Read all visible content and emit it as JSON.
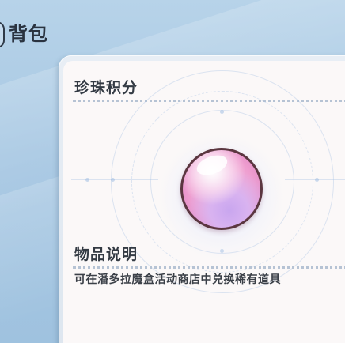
{
  "header": {
    "title": "背包",
    "back_icon": "back-tab-icon"
  },
  "item_panel": {
    "item_name": "珍珠积分",
    "item_icon": "pearl-icon",
    "description_heading": "物品说明",
    "description_text": "可在潘多拉魔盒活动商店中兑换稀有道具"
  },
  "colors": {
    "background": "#a8c8e3",
    "panel": "#fbf8f8",
    "pearl": "#ee9dcf",
    "text": "#333a43"
  }
}
